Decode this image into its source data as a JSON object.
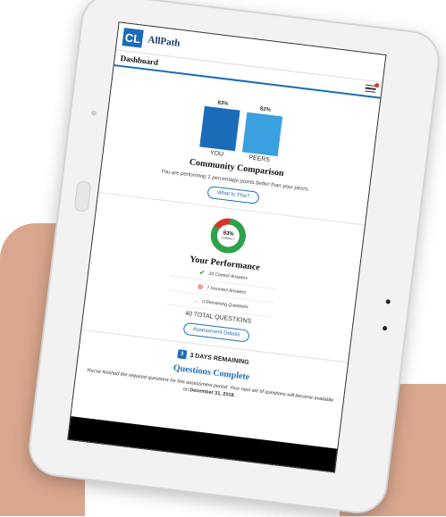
{
  "app": {
    "logo": "CL",
    "name": "AllPath",
    "page_title": "Dashboard"
  },
  "community": {
    "you_value": "83%",
    "peers_value": "82%",
    "you_label": "YOU",
    "peers_label": "PEERS",
    "title": "Community Comparison",
    "description": "You are performing 1 percentage points better than your peers.",
    "button": "What Is This?"
  },
  "chart_data": {
    "type": "bar",
    "categories": [
      "YOU",
      "PEERS"
    ],
    "values": [
      83,
      82
    ],
    "title": "Community Comparison",
    "xlabel": "",
    "ylabel": "",
    "colors": [
      "#1b6cb8",
      "#3aa0e0"
    ]
  },
  "performance": {
    "percent": "83%",
    "percent_sub": "CORRECT",
    "title": "Your Performance",
    "correct": "33 Correct Answers",
    "incorrect": "7 Incorrect Answers",
    "remaining": "0 Remaining Questions",
    "total": "40 TOTAL QUESTIONS",
    "button": "Assessment Details",
    "correct_fraction": 0.83
  },
  "status": {
    "days": "3 DAYS REMAINING",
    "cal_num": "3",
    "title": "Questions Complete",
    "message": "You've finished the required questions for this assessment period. Your next set of questions will become available on",
    "date": "December 31, 2018."
  },
  "colors": {
    "accent": "#1b6cb8",
    "correct": "#2ca34a",
    "incorrect": "#d9342b"
  }
}
